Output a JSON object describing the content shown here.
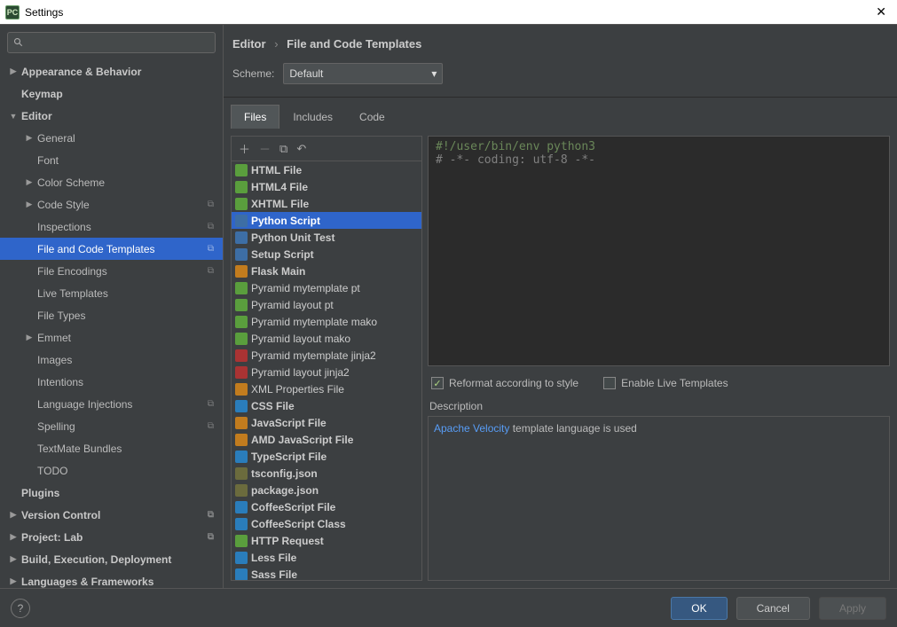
{
  "window": {
    "title": "Settings"
  },
  "sidebar": {
    "search_placeholder": "",
    "items": [
      {
        "label": "Appearance & Behavior",
        "arrow": "right",
        "bold": true,
        "lvl": 0
      },
      {
        "label": "Keymap",
        "arrow": "",
        "bold": true,
        "lvl": 0
      },
      {
        "label": "Editor",
        "arrow": "down",
        "bold": true,
        "lvl": 0
      },
      {
        "label": "General",
        "arrow": "right",
        "bold": false,
        "lvl": 1
      },
      {
        "label": "Font",
        "arrow": "",
        "bold": false,
        "lvl": 1
      },
      {
        "label": "Color Scheme",
        "arrow": "right",
        "bold": false,
        "lvl": 1
      },
      {
        "label": "Code Style",
        "arrow": "right",
        "bold": false,
        "lvl": 1,
        "copy": true
      },
      {
        "label": "Inspections",
        "arrow": "",
        "bold": false,
        "lvl": 1,
        "copy": true
      },
      {
        "label": "File and Code Templates",
        "arrow": "",
        "bold": false,
        "lvl": 1,
        "copy": true,
        "selected": true
      },
      {
        "label": "File Encodings",
        "arrow": "",
        "bold": false,
        "lvl": 1,
        "copy": true
      },
      {
        "label": "Live Templates",
        "arrow": "",
        "bold": false,
        "lvl": 1
      },
      {
        "label": "File Types",
        "arrow": "",
        "bold": false,
        "lvl": 1
      },
      {
        "label": "Emmet",
        "arrow": "right",
        "bold": false,
        "lvl": 1
      },
      {
        "label": "Images",
        "arrow": "",
        "bold": false,
        "lvl": 1
      },
      {
        "label": "Intentions",
        "arrow": "",
        "bold": false,
        "lvl": 1
      },
      {
        "label": "Language Injections",
        "arrow": "",
        "bold": false,
        "lvl": 1,
        "copy": true
      },
      {
        "label": "Spelling",
        "arrow": "",
        "bold": false,
        "lvl": 1,
        "copy": true
      },
      {
        "label": "TextMate Bundles",
        "arrow": "",
        "bold": false,
        "lvl": 1
      },
      {
        "label": "TODO",
        "arrow": "",
        "bold": false,
        "lvl": 1
      },
      {
        "label": "Plugins",
        "arrow": "",
        "bold": true,
        "lvl": 0
      },
      {
        "label": "Version Control",
        "arrow": "right",
        "bold": true,
        "lvl": 0,
        "copy": true
      },
      {
        "label": "Project: Lab",
        "arrow": "right",
        "bold": true,
        "lvl": 0,
        "copy": true
      },
      {
        "label": "Build, Execution, Deployment",
        "arrow": "right",
        "bold": true,
        "lvl": 0
      },
      {
        "label": "Languages & Frameworks",
        "arrow": "right",
        "bold": true,
        "lvl": 0
      }
    ]
  },
  "breadcrumb": {
    "root": "Editor",
    "leaf": "File and Code Templates"
  },
  "scheme": {
    "label": "Scheme:",
    "value": "Default"
  },
  "tabs": [
    "Files",
    "Includes",
    "Code"
  ],
  "active_tab": 0,
  "file_templates": [
    {
      "label": "HTML File",
      "icon": "ic-html",
      "bold": true
    },
    {
      "label": "HTML4 File",
      "icon": "ic-html",
      "bold": true
    },
    {
      "label": "XHTML File",
      "icon": "ic-html",
      "bold": true
    },
    {
      "label": "Python Script",
      "icon": "ic-py",
      "bold": true,
      "selected": true
    },
    {
      "label": "Python Unit Test",
      "icon": "ic-py",
      "bold": true
    },
    {
      "label": "Setup Script",
      "icon": "ic-py",
      "bold": true
    },
    {
      "label": "Flask Main",
      "icon": "ic-flask",
      "bold": true
    },
    {
      "label": "Pyramid mytemplate pt",
      "icon": "ic-html",
      "bold": false
    },
    {
      "label": "Pyramid layout pt",
      "icon": "ic-html",
      "bold": false
    },
    {
      "label": "Pyramid mytemplate mako",
      "icon": "ic-html",
      "bold": false
    },
    {
      "label": "Pyramid layout mako",
      "icon": "ic-html",
      "bold": false
    },
    {
      "label": "Pyramid mytemplate jinja2",
      "icon": "ic-jinja",
      "bold": false
    },
    {
      "label": "Pyramid layout jinja2",
      "icon": "ic-jinja",
      "bold": false
    },
    {
      "label": "XML Properties File",
      "icon": "ic-xml",
      "bold": false
    },
    {
      "label": "CSS File",
      "icon": "ic-css",
      "bold": true
    },
    {
      "label": "JavaScript File",
      "icon": "ic-js",
      "bold": true
    },
    {
      "label": "AMD JavaScript File",
      "icon": "ic-js",
      "bold": true
    },
    {
      "label": "TypeScript File",
      "icon": "ic-ts",
      "bold": true
    },
    {
      "label": "tsconfig.json",
      "icon": "ic-json",
      "bold": true
    },
    {
      "label": "package.json",
      "icon": "ic-json",
      "bold": true
    },
    {
      "label": "CoffeeScript File",
      "icon": "ic-coffee",
      "bold": true
    },
    {
      "label": "CoffeeScript Class",
      "icon": "ic-coffee",
      "bold": true
    },
    {
      "label": "HTTP Request",
      "icon": "ic-http",
      "bold": true
    },
    {
      "label": "Less File",
      "icon": "ic-less",
      "bold": true
    },
    {
      "label": "Sass File",
      "icon": "ic-less",
      "bold": true
    }
  ],
  "editor": {
    "line1": "#!/user/bin/env python3",
    "line2": "# -*- coding: utf-8 -*-"
  },
  "options": {
    "reformat": {
      "label": "Reformat according to style",
      "checked": true
    },
    "live": {
      "label": "Enable Live Templates",
      "checked": false
    }
  },
  "description": {
    "label": "Description",
    "link_text": "Apache Velocity",
    "rest": " template language is used"
  },
  "footer": {
    "ok": "OK",
    "cancel": "Cancel",
    "apply": "Apply"
  }
}
